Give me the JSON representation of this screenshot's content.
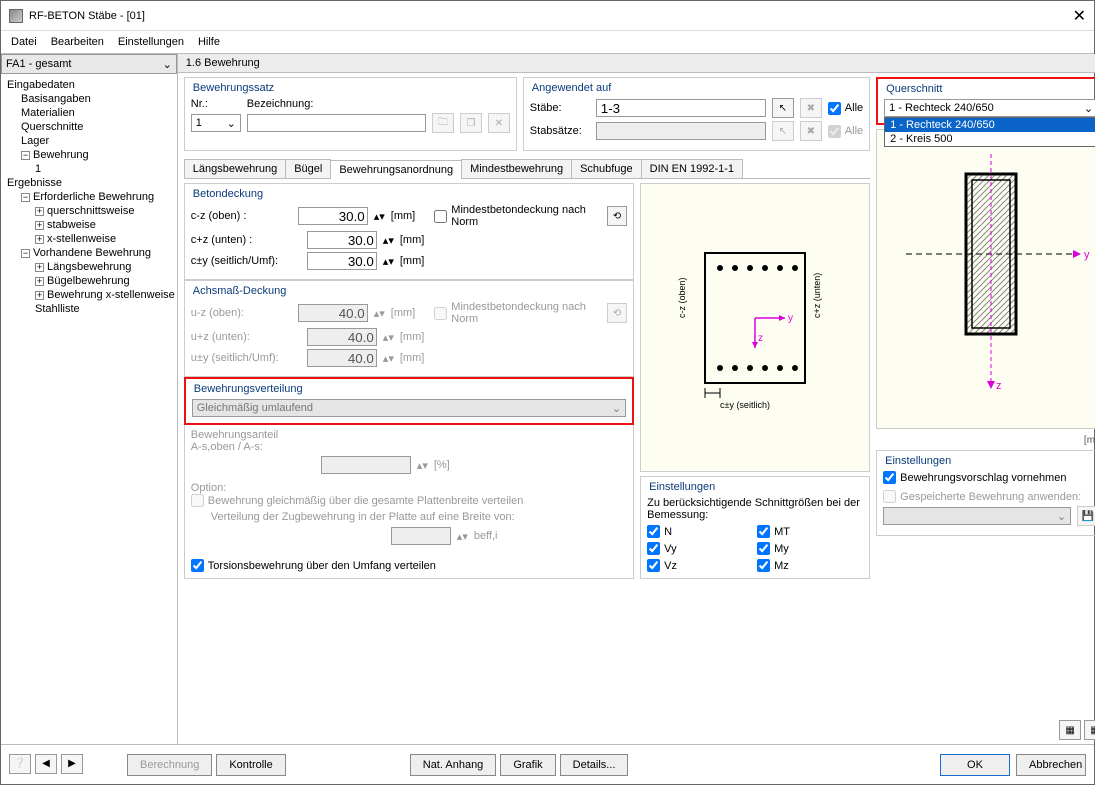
{
  "window": {
    "title": "RF-BETON Stäbe - [01]"
  },
  "menu": {
    "datei": "Datei",
    "bearbeiten": "Bearbeiten",
    "einstellungen": "Einstellungen",
    "hilfe": "Hilfe"
  },
  "fa_combo": "FA1 - gesamt",
  "tree": {
    "eingabe": "Eingabedaten",
    "basis": "Basisangaben",
    "materialien": "Materialien",
    "querschnitte": "Querschnitte",
    "lager": "Lager",
    "bewehrung": "Bewehrung",
    "bew1": "1",
    "ergebnisse": "Ergebnisse",
    "erf": "Erforderliche Bewehrung",
    "querschnittsweise": "querschnittsweise",
    "stabweise": "stabweise",
    "xstellen": "x-stellenweise",
    "vorh": "Vorhandene Bewehrung",
    "laengs": "Längsbewehrung",
    "buegel": "Bügelbewehrung",
    "bewx": "Bewehrung x-stellenweise",
    "stahl": "Stahlliste"
  },
  "section": "1.6 Bewehrung",
  "bsatz": {
    "legend": "Bewehrungssatz",
    "nr": "Nr.:",
    "bezeichnung": "Bezeichnung:",
    "nrval": "1"
  },
  "angewendet": {
    "legend": "Angewendet auf",
    "stabe": "Stäbe:",
    "stabeval": "1-3",
    "stabsatze": "Stabsätze:",
    "alle": "Alle"
  },
  "tabs": {
    "t1": "Längsbewehrung",
    "t2": "Bügel",
    "t3": "Bewehrungsanordnung",
    "t4": "Mindestbewehrung",
    "t5": "Schubfuge",
    "t6": "DIN EN 1992-1-1"
  },
  "betondeckung": {
    "legend": "Betondeckung",
    "czoben": "c-z (oben) :",
    "czunten": "c+z (unten) :",
    "cyseit": "c±y (seitlich/Umf):",
    "v_oben": "30.0",
    "v_unten": "30.0",
    "v_seit": "30.0",
    "unit": "[mm]",
    "minbtn": "Mindestbetondeckung nach Norm"
  },
  "achsmass": {
    "legend": "Achsmaß-Deckung",
    "uzoben": "u-z (oben):",
    "uzunten": "u+z (unten):",
    "uyseit": "u±y (seitlich/Umf):",
    "v_oben": "40.0",
    "v_unten": "40.0",
    "v_seit": "40.0",
    "unit": "[mm]",
    "minbtn": "Mindestbetondeckung nach Norm"
  },
  "verteilung": {
    "legend": "Bewehrungsverteilung",
    "combo": "Gleichmäßig umlaufend",
    "anteil": "Bewehrungsanteil\nA-s,oben / A-s:",
    "pct": "[%]",
    "option": "Option:",
    "chk1": "Bewehrung gleichmäßig über die gesamte Plattenbreite verteilen",
    "sub": "Verteilung der Zugbewehrung in der Platte auf eine Breite von:",
    "beff": "beff,i",
    "chk_tors": "Torsionsbewehrung über den Umfang verteilen"
  },
  "einstellungen_mid": {
    "legend": "Einstellungen",
    "desc": "Zu berücksichtigende Schnittgrößen bei der Bemessung:",
    "n": "N",
    "vy": "Vy",
    "vz": "Vz",
    "mt": "MT",
    "my": "My",
    "mz": "Mz"
  },
  "querschnitt": {
    "legend": "Querschnitt",
    "value": "1 - Rechteck 240/650",
    "opt1": "1 - Rechteck 240/650",
    "opt2": "2 - Kreis 500",
    "unit": "[mm]"
  },
  "einst_right": {
    "legend": "Einstellungen",
    "chk1": "Bewehrungsvorschlag vornehmen",
    "chk2": "Gespeicherte Bewehrung anwenden:"
  },
  "diagram": {
    "cz_oben": "c-z (oben)",
    "cz_unten": "c+z (unten)",
    "cy_seit": "c±y (seitlich)",
    "y": "y",
    "z": "z"
  },
  "footer": {
    "berechnung": "Berechnung",
    "kontrolle": "Kontrolle",
    "nat": "Nat. Anhang",
    "grafik": "Grafik",
    "details": "Details...",
    "ok": "OK",
    "abbrechen": "Abbrechen"
  }
}
